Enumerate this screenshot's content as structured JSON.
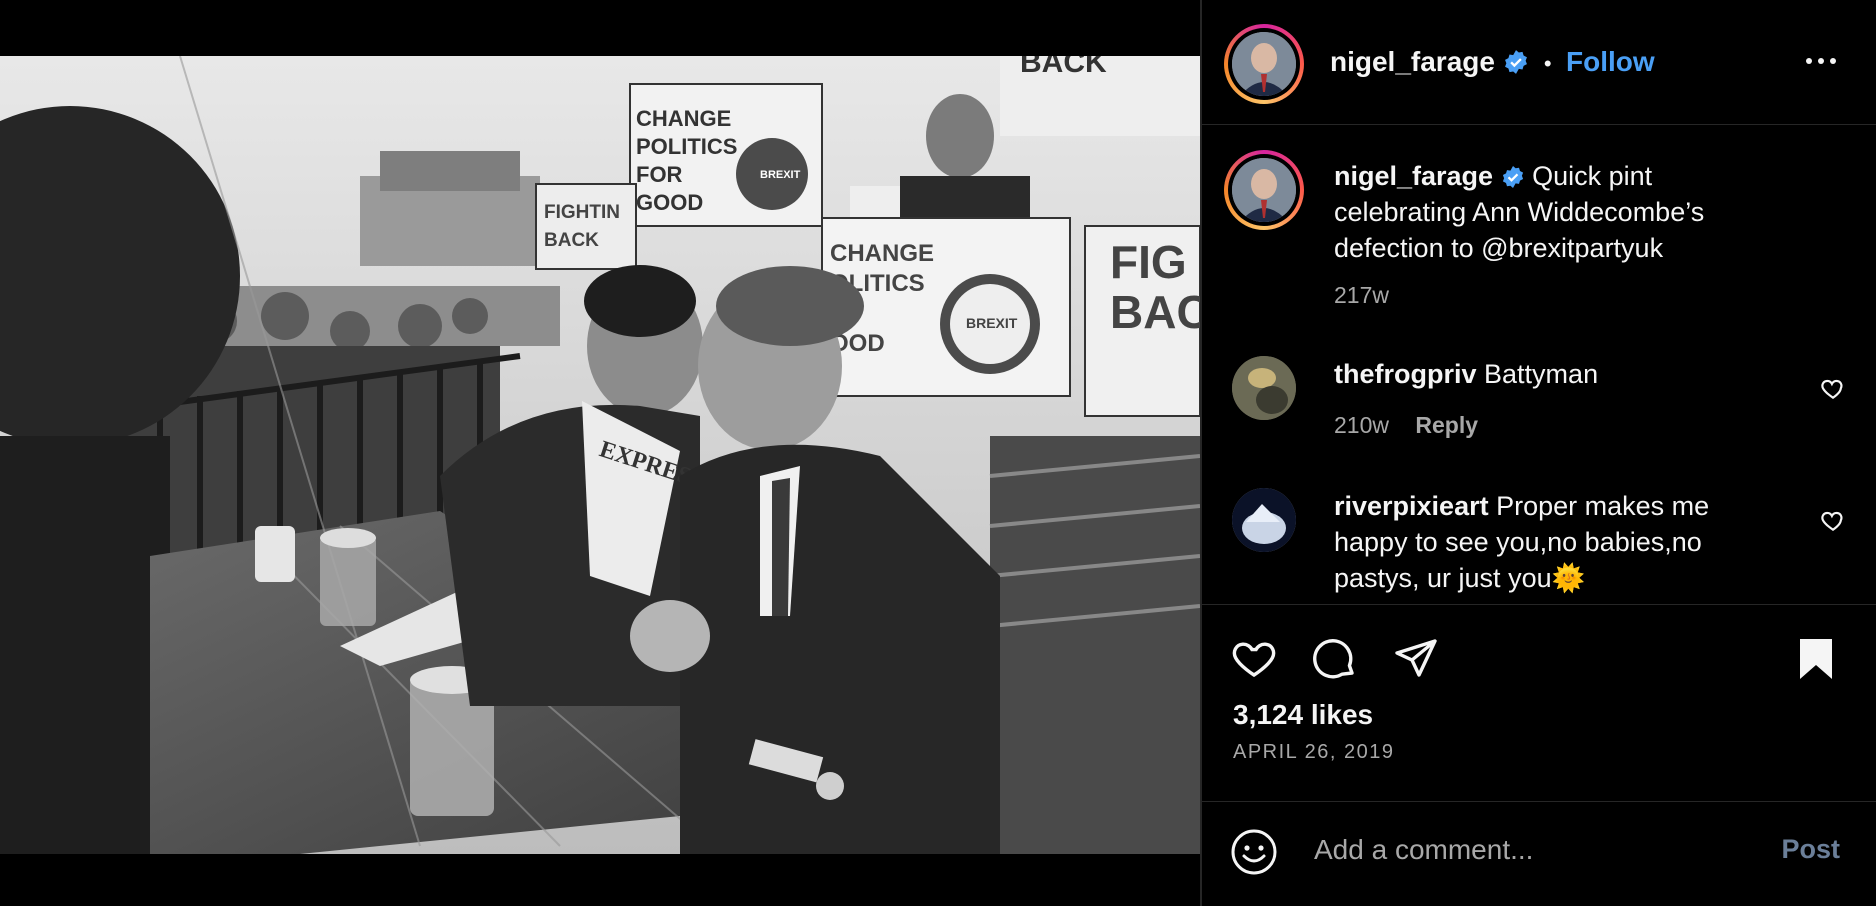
{
  "post": {
    "author": "nigel_farage",
    "follow_label": "Follow",
    "dot": "•",
    "caption": "Quick pint celebrating Ann Widdecombe’s defection to @brexitpartyuk",
    "caption_age": "217w"
  },
  "photo_text": {
    "sign1": "CHANGE\nPOLITICS\nFOR\nGOOD",
    "sign2": "FIGHTING\nBACK",
    "sign3": "CHANGE\nPOLITICS\nFOR\nGOOD",
    "sign4": "FIG\nBAC",
    "sign5": "BACK",
    "badge": "BREXIT\nPARTY",
    "newspaper": "EXPRESS"
  },
  "comments": [
    {
      "user": "thefrogpriv",
      "text": "Battyman",
      "age": "210w",
      "reply": "Reply"
    },
    {
      "user": "riverpixieart",
      "text": "Proper makes me happy to see you,no babies,no pastys, ur just you🌞"
    }
  ],
  "engagement": {
    "likes": "3,124 likes",
    "date": "APRIL 26, 2019"
  },
  "composer": {
    "placeholder": "Add a comment...",
    "post_label": "Post"
  },
  "colors": {
    "accent": "#4a9ff5",
    "background": "#000000",
    "muted": "#a8a8a8"
  },
  "icons": [
    "verified-icon",
    "more-options-icon",
    "heart-icon",
    "comment-icon",
    "share-icon",
    "bookmark-icon",
    "emoji-icon"
  ]
}
